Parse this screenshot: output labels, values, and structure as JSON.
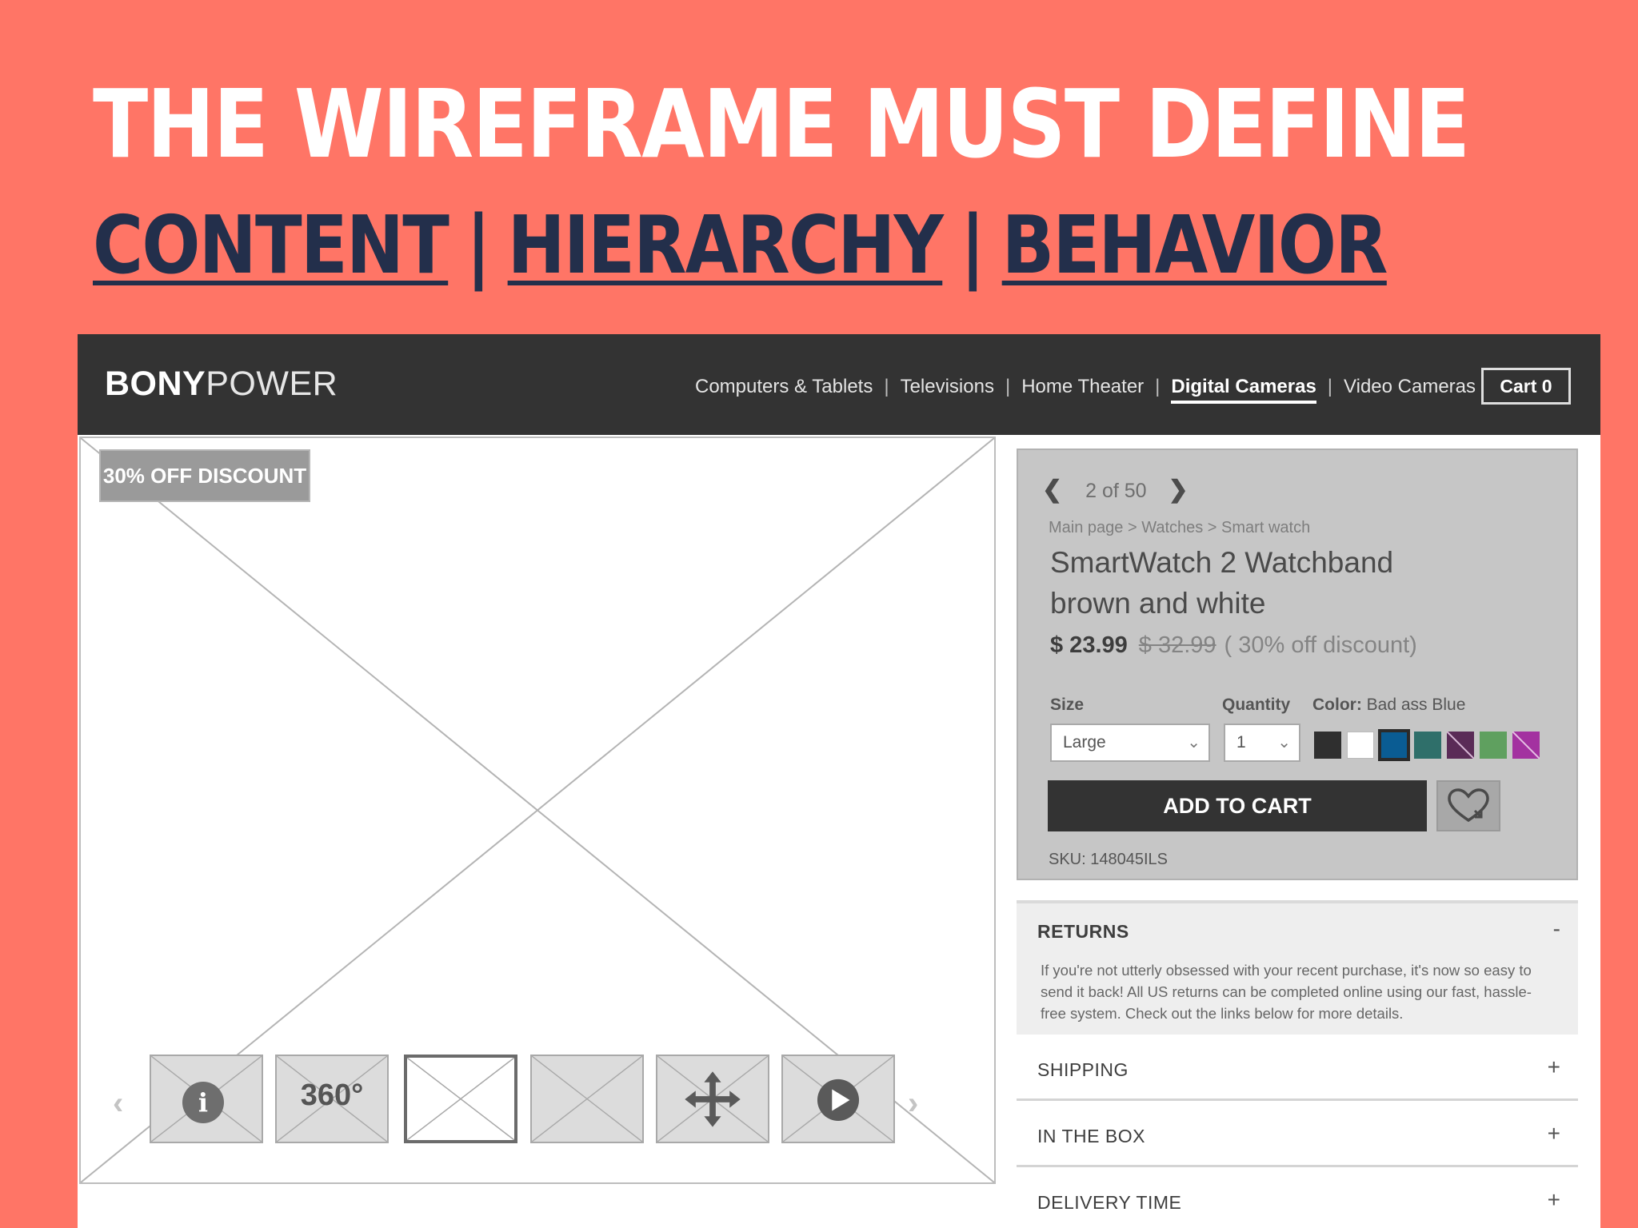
{
  "slide": {
    "headline": "THE WIREFRAME MUST DEFINE",
    "subhead": {
      "content": "CONTENT",
      "sep": "|",
      "hierarchy": "HIERARCHY",
      "behavior": "BEHAVIOR"
    }
  },
  "header": {
    "logo_bold": "BONY",
    "logo_light": "POWER",
    "nav": [
      "Computers & Tablets",
      "Televisions",
      "Home Theater",
      "Digital Cameras",
      "Video Cameras"
    ],
    "nav_sep": "|",
    "active_nav": "Digital Cameras",
    "cart_label": "Cart 0"
  },
  "gallery": {
    "badge": "30% OFF DISCOUNT",
    "thumbs": [
      {
        "icon": "info-icon",
        "glyph": "i"
      },
      {
        "icon": "360-icon",
        "text": "360°"
      },
      {
        "icon": "image-placeholder-icon",
        "selected": true
      },
      {
        "icon": "image-placeholder-icon"
      },
      {
        "icon": "move-arrows-icon"
      },
      {
        "icon": "play-icon"
      }
    ]
  },
  "product": {
    "pager": "2 of 50",
    "breadcrumb": "Main page > Watches > Smart watch",
    "title_line1": "SmartWatch 2 Watchband",
    "title_line2": "brown and white",
    "price": "$ 23.99",
    "old_price": "$ 32.99",
    "discount_note": "( 30% off discount)",
    "size_label": "Size",
    "size_value": "Large",
    "quantity_label": "Quantity",
    "quantity_value": "1",
    "color_label": "Color:",
    "color_value": "Bad ass Blue",
    "swatches": [
      "#2f2f2f",
      "#ffffff",
      "#0a5c93",
      "#2f6f6a",
      "#5a2b57",
      "#5fa05f",
      "#a332a0"
    ],
    "add_to_cart": "ADD TO CART",
    "sku": "SKU: 148045ILS"
  },
  "accordion": {
    "returns": {
      "title": "RETURNS",
      "toggle": "-",
      "body": "If you're not utterly obsessed with your recent purchase, it's now so easy to send it back! All US returns can be completed online using our fast, hassle-free system. Check out the links below for more details."
    },
    "shipping": {
      "title": "SHIPPING",
      "toggle": "+"
    },
    "in_the_box": {
      "title": "IN THE BOX",
      "toggle": "+"
    },
    "delivery_time": {
      "title": "DELIVERY TIME",
      "toggle": "+"
    }
  }
}
